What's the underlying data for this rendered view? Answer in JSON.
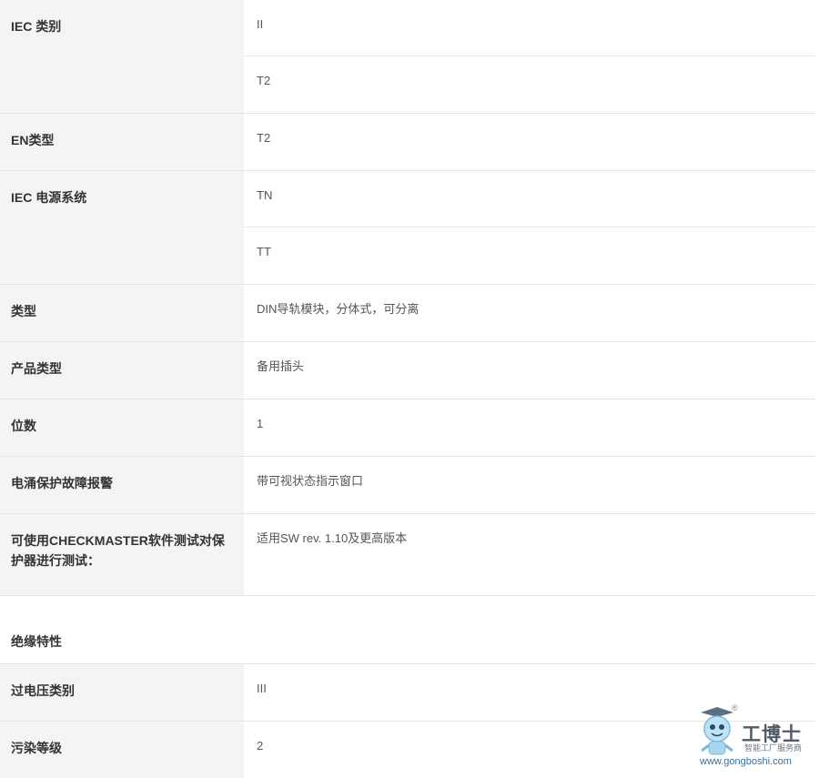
{
  "rows": [
    {
      "label": "IEC 类别",
      "values": [
        "II",
        "T2"
      ]
    },
    {
      "label": "EN类型",
      "values": [
        "T2"
      ]
    },
    {
      "label": "IEC 电源系统",
      "values": [
        "TN",
        "TT"
      ]
    },
    {
      "label": "类型",
      "values": [
        "DIN导轨模块，分体式，可分离"
      ]
    },
    {
      "label": "产品类型",
      "values": [
        "备用插头"
      ]
    },
    {
      "label": "位数",
      "values": [
        "1"
      ]
    },
    {
      "label": "电涌保护故障报警",
      "values": [
        "带可视状态指示窗口"
      ]
    },
    {
      "label": "可使用CHECKMASTER软件测试对保护器进行测试：",
      "values": [
        "适用SW rev. 1.10及更高版本"
      ]
    }
  ],
  "section_title": "绝缘特性",
  "rows2": [
    {
      "label": "过电压类别",
      "values": [
        "III"
      ]
    },
    {
      "label": "污染等级",
      "values": [
        "2"
      ]
    }
  ],
  "watermark": {
    "brand": "工博士",
    "tagline": "智能工厂服务商",
    "url": "www.gongboshi.com",
    "reg": "®"
  }
}
